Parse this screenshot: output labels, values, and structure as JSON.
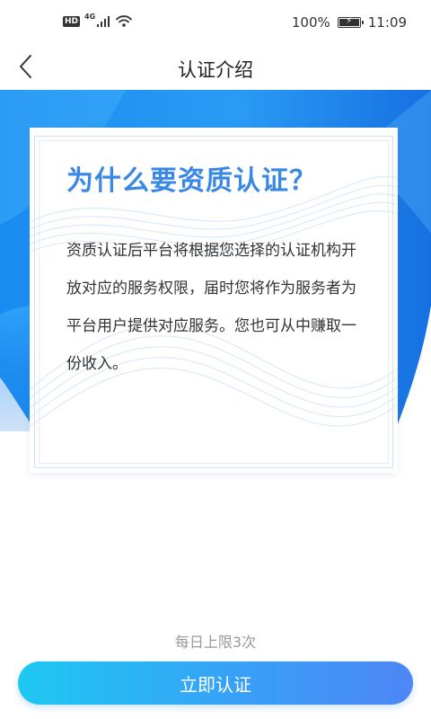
{
  "status_bar": {
    "hd": "HD",
    "network": "4G",
    "battery_percent": "100%",
    "battery_level": 1.0,
    "time": "11:09"
  },
  "nav": {
    "title": "认证介绍",
    "back_icon": "chevron-left-icon"
  },
  "card": {
    "heading": "为什么要资质认证？",
    "body": "资质认证后平台将根据您选择的认证机构开放对应的服务权限，届时您将作为服务者为平台用户提供对应服务。您也可从中赚取一份收入。"
  },
  "footer": {
    "limit_note": "每日上限3次",
    "certify_label": "立即认证"
  },
  "colors": {
    "heading": "#3a88e6",
    "hero_blue": "#1f84ec",
    "button_start": "#1ec8f2",
    "button_end": "#4e86f5"
  }
}
